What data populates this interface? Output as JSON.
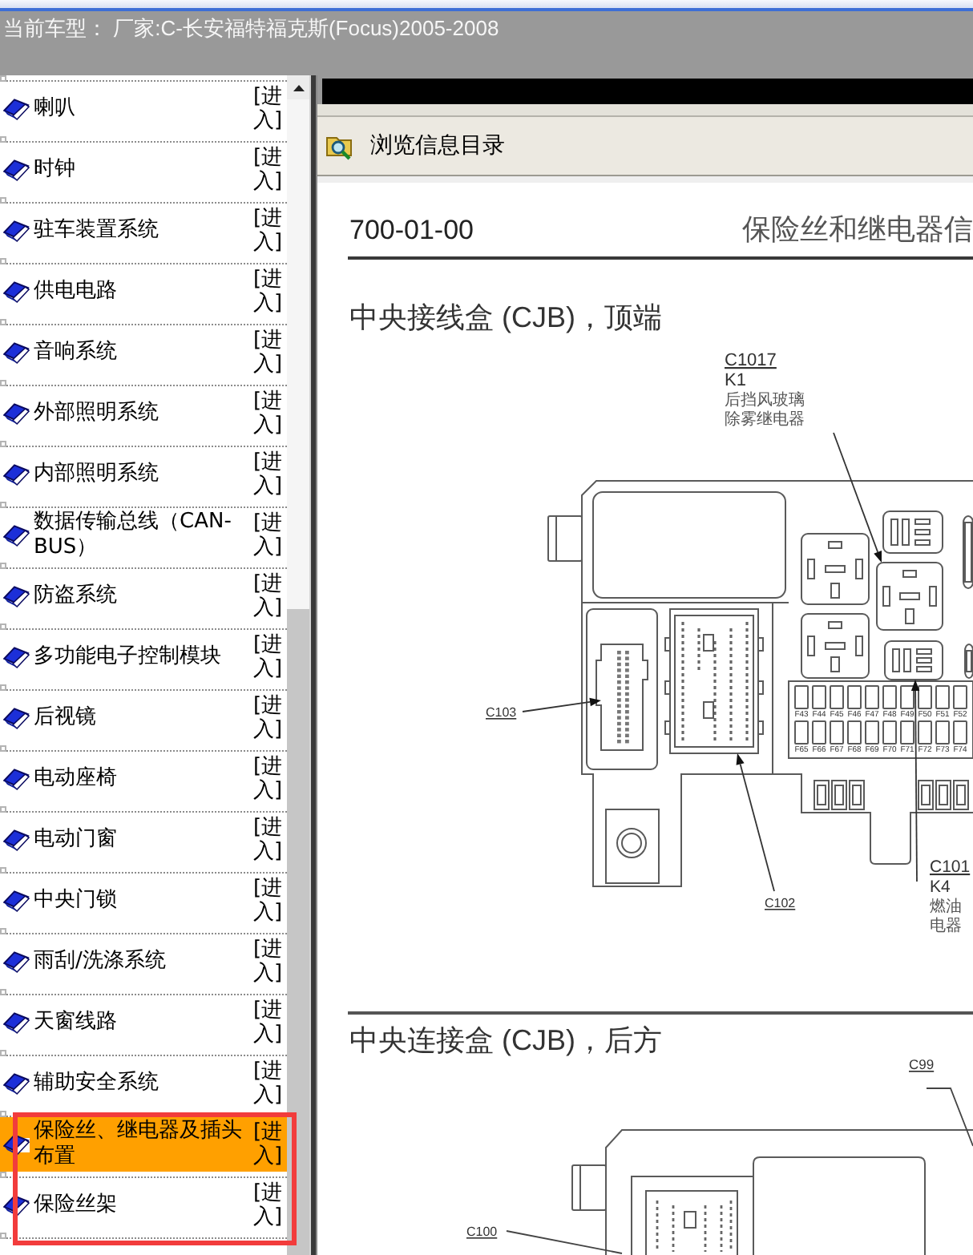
{
  "current_model": "当前车型： 厂家:C-长安福特福克斯(Focus)2005-2008",
  "sidebar": {
    "items": [
      {
        "label": "喇叭",
        "link": "[进入]",
        "selected": false,
        "outlined": false
      },
      {
        "label": "时钟",
        "link": "[进入]",
        "selected": false,
        "outlined": false
      },
      {
        "label": "驻车装置系统",
        "link": "[进入]",
        "selected": false,
        "outlined": false
      },
      {
        "label": "供电电路",
        "link": "[进入]",
        "selected": false,
        "outlined": false
      },
      {
        "label": "音响系统",
        "link": "[进入]",
        "selected": false,
        "outlined": false
      },
      {
        "label": "外部照明系统",
        "link": "[进入]",
        "selected": false,
        "outlined": false
      },
      {
        "label": "内部照明系统",
        "link": "[进入]",
        "selected": false,
        "outlined": false
      },
      {
        "label": "数据传输总线（CAN-BUS）",
        "link": "[进入]",
        "selected": false,
        "outlined": false
      },
      {
        "label": "防盗系统",
        "link": "[进入]",
        "selected": false,
        "outlined": false
      },
      {
        "label": "多功能电子控制模块",
        "link": "[进入]",
        "selected": false,
        "outlined": false
      },
      {
        "label": "后视镜",
        "link": "[进入]",
        "selected": false,
        "outlined": false
      },
      {
        "label": "电动座椅",
        "link": "[进入]",
        "selected": false,
        "outlined": false
      },
      {
        "label": "电动门窗",
        "link": "[进入]",
        "selected": false,
        "outlined": false
      },
      {
        "label": "中央门锁",
        "link": "[进入]",
        "selected": false,
        "outlined": false
      },
      {
        "label": "雨刮/洗涤系统",
        "link": "[进入]",
        "selected": false,
        "outlined": false
      },
      {
        "label": "天窗线路",
        "link": "[进入]",
        "selected": false,
        "outlined": false
      },
      {
        "label": "辅助安全系统",
        "link": "[进入]",
        "selected": false,
        "outlined": false
      },
      {
        "label": "保险丝、继电器及插头布置",
        "link": "[进入]",
        "selected": true,
        "outlined": true
      },
      {
        "label": "保险丝架",
        "link": "[进入]",
        "selected": false,
        "outlined": true
      }
    ]
  },
  "viewer": {
    "toolbar": {
      "title": "浏览信息目录"
    },
    "document": {
      "code": "700-01-00",
      "title": "保险丝和继电器信",
      "sections": [
        {
          "kind": "top",
          "heading": "中央接线盒 (CJB)，顶端",
          "callouts": [
            {
              "connector": "C1017",
              "relay": "K1",
              "lines": [
                "后挡风玻璃",
                "除雾继电器"
              ]
            },
            {
              "connector": "C103"
            },
            {
              "connector": "C102"
            },
            {
              "connector": "C101",
              "relay": "K4",
              "lines": [
                "燃油",
                "电器"
              ]
            }
          ],
          "fuse_rows": [
            [
              "F43",
              "F44",
              "F45",
              "F46",
              "F47",
              "F48",
              "F49",
              "F50",
              "F51",
              "F52"
            ],
            [
              "F65",
              "F66",
              "F67",
              "F68",
              "F69",
              "F70",
              "F71",
              "F72",
              "F73",
              "F74"
            ]
          ]
        },
        {
          "kind": "rear",
          "heading": "中央连接盒 (CJB)，后方",
          "callouts": [
            {
              "connector": "C99"
            },
            {
              "connector": "C100"
            }
          ]
        }
      ]
    }
  }
}
